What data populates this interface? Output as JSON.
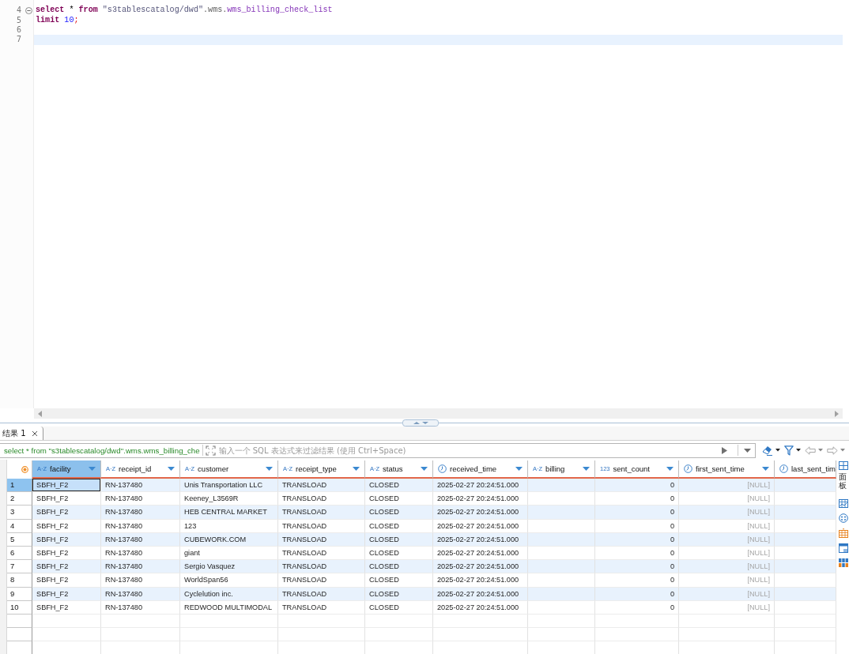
{
  "editor": {
    "lines": [
      {
        "number": "4",
        "foldable": true,
        "current": false,
        "tokens": [
          {
            "text": "select",
            "kind": "keyword"
          },
          {
            "text": " * ",
            "kind": "plain"
          },
          {
            "text": "from",
            "kind": "keyword"
          },
          {
            "text": " \"s3tablescatalog/dwd\"",
            "kind": "string"
          },
          {
            "text": ".wms.",
            "kind": "schema"
          },
          {
            "text": "wms_billing_check_list",
            "kind": "table"
          }
        ]
      },
      {
        "number": "5",
        "foldable": false,
        "current": false,
        "tokens": [
          {
            "text": "limit",
            "kind": "keyword"
          },
          {
            "text": " 10",
            "kind": "number"
          },
          {
            "text": ";",
            "kind": "delimiter"
          }
        ]
      },
      {
        "number": "6",
        "foldable": false,
        "current": false
      },
      {
        "number": "7",
        "foldable": false,
        "current": true
      }
    ]
  },
  "results": {
    "tabs": [
      {
        "label": "结果 1",
        "selected": true
      }
    ],
    "filter": {
      "query": "select * from \"s3tablescatalog/dwd\".wms.wms_billing_che",
      "placeholder": "输入一个 SQL 表达式来过滤结果 (使用 Ctrl+Space)"
    },
    "side_panel": {
      "label": "面板"
    },
    "table": {
      "columns": [
        {
          "name": "facility",
          "kind": "text",
          "type_glyph": "A·Z",
          "selected": true
        },
        {
          "name": "receipt_id",
          "kind": "text",
          "type_glyph": "A·Z",
          "selected": false
        },
        {
          "name": "customer",
          "kind": "text",
          "type_glyph": "A·Z",
          "selected": false
        },
        {
          "name": "receipt_type",
          "kind": "text",
          "type_glyph": "A·Z",
          "selected": false
        },
        {
          "name": "status",
          "kind": "text",
          "type_glyph": "A·Z",
          "selected": false
        },
        {
          "name": "received_time",
          "kind": "time",
          "selected": false
        },
        {
          "name": "billing",
          "kind": "text",
          "type_glyph": "A·Z",
          "selected": false
        },
        {
          "name": "sent_count",
          "kind": "number",
          "type_glyph": "123",
          "selected": false
        },
        {
          "name": "first_sent_time",
          "kind": "time",
          "selected": false
        },
        {
          "name": "last_sent_tim",
          "kind": "time",
          "selected": false
        }
      ],
      "rows": [
        {
          "number": "1",
          "selected": true,
          "cells": [
            {
              "text": "SBFH_F2",
              "is_null": false
            },
            {
              "text": "RN-137480",
              "is_null": false
            },
            {
              "text": "Unis Transportation LLC",
              "is_null": false
            },
            {
              "text": "TRANSLOAD",
              "is_null": false
            },
            {
              "text": "CLOSED",
              "is_null": false
            },
            {
              "text": "2025-02-27 20:24:51.000",
              "is_null": false
            },
            null,
            {
              "text": "0",
              "is_null": false
            },
            {
              "text": "[NULL]",
              "is_null": true
            },
            null
          ]
        },
        {
          "number": "2",
          "selected": false,
          "cells": [
            {
              "text": "SBFH_F2",
              "is_null": false
            },
            {
              "text": "RN-137480",
              "is_null": false
            },
            {
              "text": "Keeney_L3569R",
              "is_null": false
            },
            {
              "text": "TRANSLOAD",
              "is_null": false
            },
            {
              "text": "CLOSED",
              "is_null": false
            },
            {
              "text": "2025-02-27 20:24:51.000",
              "is_null": false
            },
            null,
            {
              "text": "0",
              "is_null": false
            },
            {
              "text": "[NULL]",
              "is_null": true
            },
            null
          ]
        },
        {
          "number": "3",
          "selected": false,
          "cells": [
            {
              "text": "SBFH_F2",
              "is_null": false
            },
            {
              "text": "RN-137480",
              "is_null": false
            },
            {
              "text": "HEB CENTRAL MARKET",
              "is_null": false
            },
            {
              "text": "TRANSLOAD",
              "is_null": false
            },
            {
              "text": "CLOSED",
              "is_null": false
            },
            {
              "text": "2025-02-27 20:24:51.000",
              "is_null": false
            },
            null,
            {
              "text": "0",
              "is_null": false
            },
            {
              "text": "[NULL]",
              "is_null": true
            },
            null
          ]
        },
        {
          "number": "4",
          "selected": false,
          "cells": [
            {
              "text": "SBFH_F2",
              "is_null": false
            },
            {
              "text": "RN-137480",
              "is_null": false
            },
            {
              "text": "123",
              "is_null": false
            },
            {
              "text": "TRANSLOAD",
              "is_null": false
            },
            {
              "text": "CLOSED",
              "is_null": false
            },
            {
              "text": "2025-02-27 20:24:51.000",
              "is_null": false
            },
            null,
            {
              "text": "0",
              "is_null": false
            },
            {
              "text": "[NULL]",
              "is_null": true
            },
            null
          ]
        },
        {
          "number": "5",
          "selected": false,
          "cells": [
            {
              "text": "SBFH_F2",
              "is_null": false
            },
            {
              "text": "RN-137480",
              "is_null": false
            },
            {
              "text": "CUBEWORK.COM",
              "is_null": false
            },
            {
              "text": "TRANSLOAD",
              "is_null": false
            },
            {
              "text": "CLOSED",
              "is_null": false
            },
            {
              "text": "2025-02-27 20:24:51.000",
              "is_null": false
            },
            null,
            {
              "text": "0",
              "is_null": false
            },
            {
              "text": "[NULL]",
              "is_null": true
            },
            null
          ]
        },
        {
          "number": "6",
          "selected": false,
          "cells": [
            {
              "text": "SBFH_F2",
              "is_null": false
            },
            {
              "text": "RN-137480",
              "is_null": false
            },
            {
              "text": "giant",
              "is_null": false
            },
            {
              "text": "TRANSLOAD",
              "is_null": false
            },
            {
              "text": "CLOSED",
              "is_null": false
            },
            {
              "text": "2025-02-27 20:24:51.000",
              "is_null": false
            },
            null,
            {
              "text": "0",
              "is_null": false
            },
            {
              "text": "[NULL]",
              "is_null": true
            },
            null
          ]
        },
        {
          "number": "7",
          "selected": false,
          "cells": [
            {
              "text": "SBFH_F2",
              "is_null": false
            },
            {
              "text": "RN-137480",
              "is_null": false
            },
            {
              "text": "Sergio Vasquez",
              "is_null": false
            },
            {
              "text": "TRANSLOAD",
              "is_null": false
            },
            {
              "text": "CLOSED",
              "is_null": false
            },
            {
              "text": "2025-02-27 20:24:51.000",
              "is_null": false
            },
            null,
            {
              "text": "0",
              "is_null": false
            },
            {
              "text": "[NULL]",
              "is_null": true
            },
            null
          ]
        },
        {
          "number": "8",
          "selected": false,
          "cells": [
            {
              "text": "SBFH_F2",
              "is_null": false
            },
            {
              "text": "RN-137480",
              "is_null": false
            },
            {
              "text": "WorldSpan56",
              "is_null": false
            },
            {
              "text": "TRANSLOAD",
              "is_null": false
            },
            {
              "text": "CLOSED",
              "is_null": false
            },
            {
              "text": "2025-02-27 20:24:51.000",
              "is_null": false
            },
            null,
            {
              "text": "0",
              "is_null": false
            },
            {
              "text": "[NULL]",
              "is_null": true
            },
            null
          ]
        },
        {
          "number": "9",
          "selected": false,
          "cells": [
            {
              "text": "SBFH_F2",
              "is_null": false
            },
            {
              "text": "RN-137480",
              "is_null": false
            },
            {
              "text": "Cyclelution inc.",
              "is_null": false
            },
            {
              "text": "TRANSLOAD",
              "is_null": false
            },
            {
              "text": "CLOSED",
              "is_null": false
            },
            {
              "text": "2025-02-27 20:24:51.000",
              "is_null": false
            },
            null,
            {
              "text": "0",
              "is_null": false
            },
            {
              "text": "[NULL]",
              "is_null": true
            },
            null
          ]
        },
        {
          "number": "10",
          "selected": false,
          "cells": [
            {
              "text": "SBFH_F2",
              "is_null": false
            },
            {
              "text": "RN-137480",
              "is_null": false
            },
            {
              "text": "REDWOOD MULTIMODAL",
              "is_null": false
            },
            {
              "text": "TRANSLOAD",
              "is_null": false
            },
            {
              "text": "CLOSED",
              "is_null": false
            },
            {
              "text": "2025-02-27 20:24:51.000",
              "is_null": false
            },
            null,
            {
              "text": "0",
              "is_null": false
            },
            {
              "text": "[NULL]",
              "is_null": true
            },
            null
          ]
        }
      ]
    }
  }
}
